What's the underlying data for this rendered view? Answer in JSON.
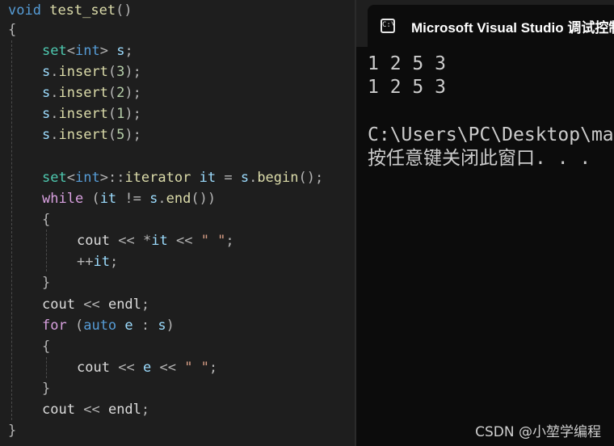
{
  "editor": {
    "lines": [
      "void test_set()",
      "{",
      "set<int> s;",
      "s.insert(3);",
      "s.insert(2);",
      "s.insert(1);",
      "s.insert(5);",
      "set<int>::iterator it = s.begin();",
      "while (it != s.end())",
      "{",
      "cout << *it << \" \";",
      "++it;",
      "}",
      "cout << endl;",
      "for (auto e : s)",
      "{",
      "cout << e << \" \";",
      "}",
      "cout << endl;",
      "}"
    ]
  },
  "console": {
    "icon_label": "C:\\",
    "window_title": "Microsoft Visual Studio 调试控制台",
    "output": [
      "1 2 5 3",
      "1 2 5 3",
      "",
      "C:\\Users\\PC\\Desktop\\ma",
      "按任意键关闭此窗口. . ."
    ]
  },
  "watermark": "CSDN @小堃学编程"
}
